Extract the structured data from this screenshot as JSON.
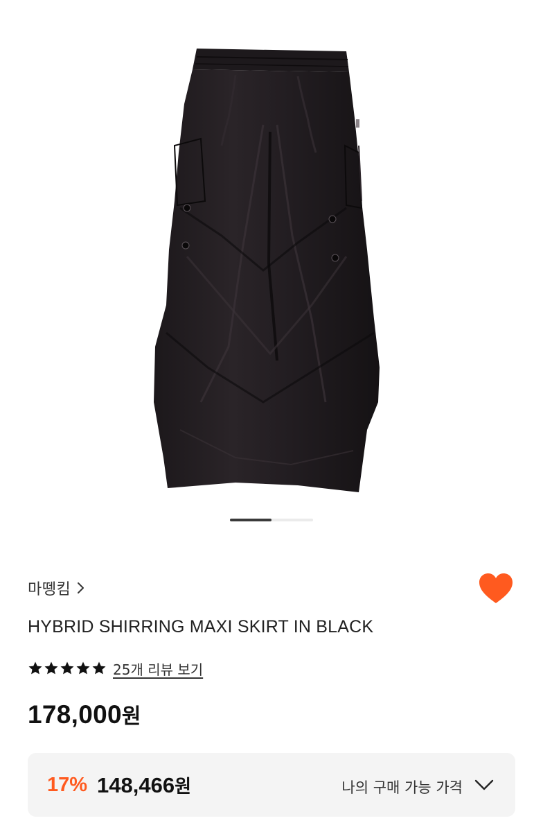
{
  "gallery": {
    "image_alt": "HYBRID SHIRRING MAXI SKIRT IN BLACK",
    "current_index": 1,
    "total_images": 2,
    "progress": 0.5
  },
  "product": {
    "brand": "마뗑킴",
    "brand_chevron_icon": "chevron-right-icon",
    "title": "HYBRID SHIRRING MAXI SKIRT IN BLACK",
    "wishlisted": true,
    "wishlist_icon": "heart-icon",
    "rating": 5,
    "max_rating": 5,
    "review_link": "25개 리뷰 보기",
    "list_price": "178,000",
    "currency": "원"
  },
  "best_price": {
    "discount": "17%",
    "price": "148,466",
    "currency": "원",
    "label": "나의 구매 가능 가격",
    "expand_icon": "chevron-down-icon"
  },
  "colors": {
    "accent": "#ff5a1f",
    "text": "#111111",
    "box_bg": "#f4f4f4",
    "star": "#111111"
  }
}
